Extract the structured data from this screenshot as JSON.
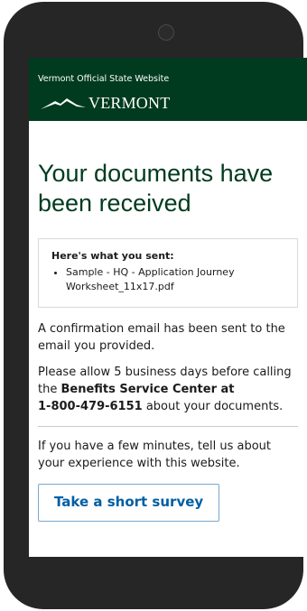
{
  "header": {
    "tagline": "Vermont Official State Website",
    "logo_text": "VERMONT"
  },
  "main": {
    "title": "Your documents have been received",
    "sent_box": {
      "heading": "Here's what you sent:",
      "files": [
        "Sample - HQ - Application Journey Worksheet_11x17.pdf"
      ]
    },
    "confirmation_text": "A confirmation email has been sent to the email you provided.",
    "allow_text_before": "Please allow 5 business days before calling the ",
    "service_center": "Benefits Service Center at",
    "phone": "1-800-479-6151",
    "allow_text_after": " about your documents.",
    "survey_prompt": "If you have a few minutes, tell us about your experience with this website.",
    "survey_button": "Take a short survey"
  },
  "colors": {
    "header_bg": "#003b1f",
    "title": "#003b1f",
    "link": "#005ea2",
    "device": "#262626"
  },
  "icons": {
    "camera": "camera-icon",
    "logo": "vermont-mountain-logo-icon"
  }
}
